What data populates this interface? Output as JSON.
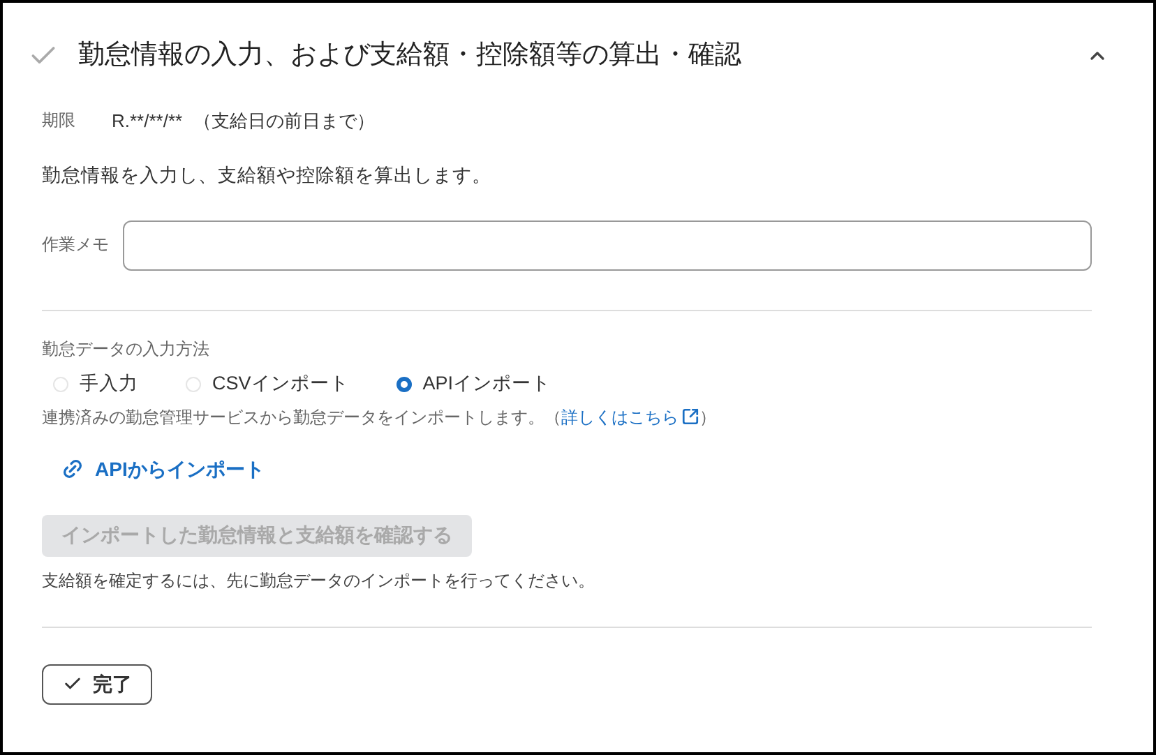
{
  "panel": {
    "title": "勤怠情報の入力、および支給額・控除額等の算出・確認",
    "completed": true,
    "expanded": true
  },
  "deadline": {
    "label": "期限",
    "value": "R.**/**/**",
    "note": "（支給日の前日まで）"
  },
  "description": "勤怠情報を入力し、支給額や控除額を算出します。",
  "memo": {
    "label": "作業メモ"
  },
  "input_method": {
    "label": "勤怠データの入力方法",
    "options": [
      {
        "label": "手入力",
        "selected": false
      },
      {
        "label": "CSVインポート",
        "selected": false
      },
      {
        "label": "APIインポート",
        "selected": true
      }
    ],
    "note_before": "連携済みの勤怠管理サービスから勤怠データをインポートします。（",
    "note_link": "詳しくはこちら",
    "note_after": "）"
  },
  "api_link": "APIからインポート",
  "confirm_button": {
    "label": "インポートした勤怠情報と支給額を確認する",
    "disabled": true
  },
  "hint": "支給額を確定するには、先に勤怠データのインポートを行ってください。",
  "done_button": "完了"
}
